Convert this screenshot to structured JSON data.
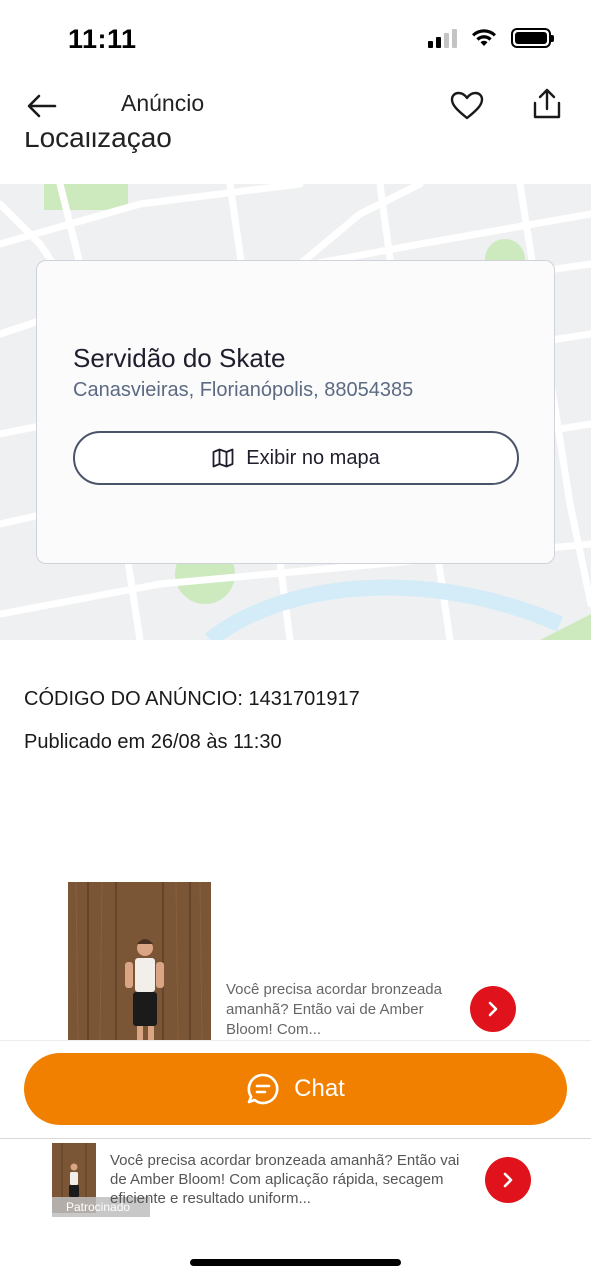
{
  "status_bar": {
    "time": "11:11",
    "icons": [
      "signal-icon",
      "wifi-icon",
      "battery-icon"
    ]
  },
  "header": {
    "title": "Anúncio",
    "back_icon": "arrow-left-icon",
    "favorite_icon": "heart-icon",
    "share_icon": "share-icon"
  },
  "location": {
    "section_title": "Localização",
    "name": "Servidão do Skate",
    "address": "Canasvieiras, Florianópolis, 88054385",
    "map_button_label": "Exibir no mapa",
    "map_button_icon": "map-icon"
  },
  "details": {
    "ad_code": "CÓDIGO DO ANÚNCIO: 1431701917",
    "published": "Publicado em 26/08 às 11:30"
  },
  "inline_ad": {
    "text": "Você precisa acordar bronzeada amanhã? Então vai de Amber Bloom! Com...",
    "arrow_icon": "chevron-right-icon"
  },
  "chat": {
    "label": "Chat",
    "icon": "chat-bubble-icon",
    "color": "#f28000"
  },
  "banner_ad": {
    "text": "Você precisa acordar bronzeada amanhã? Então vai de Amber Bloom! Com aplicação rápida, secagem eficiente e resultado uniform...",
    "sponsored_label": "Patrocinado",
    "arrow_icon": "chevron-right-icon",
    "arrow_color": "#e0121b"
  }
}
